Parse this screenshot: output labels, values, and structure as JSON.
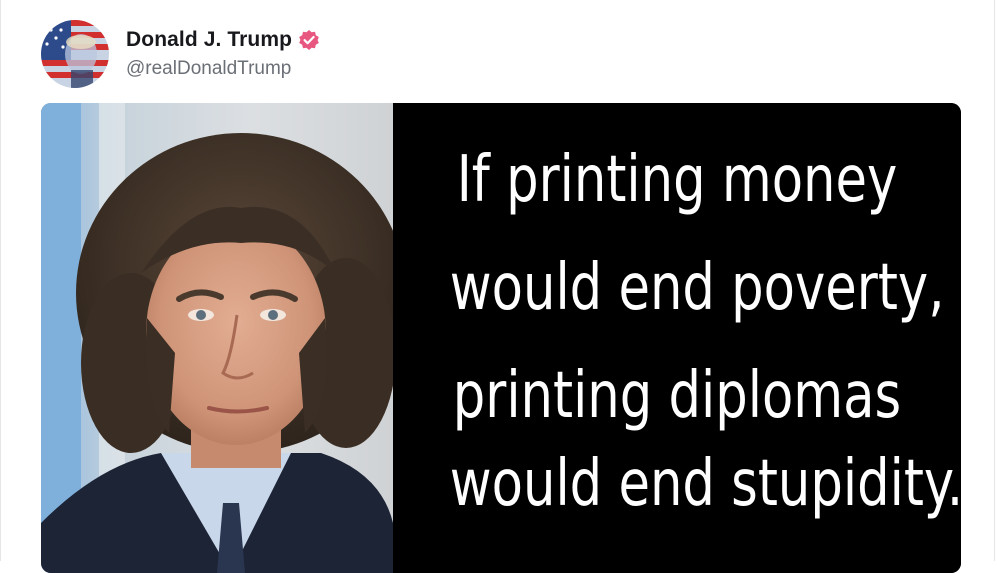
{
  "post": {
    "author": {
      "display_name": "Donald J. Trump",
      "handle": "@realDonaldTrump",
      "verified": true,
      "verified_color": "#e8577f",
      "avatar_icon": "flag-portrait-avatar"
    },
    "media": {
      "photo_icon": "portrait-photo",
      "quote_lines": [
        "If printing money",
        "would end poverty,",
        "printing diplomas",
        "would end stupidity."
      ],
      "quote_background": "#000000",
      "quote_color": "#ffffff"
    }
  }
}
